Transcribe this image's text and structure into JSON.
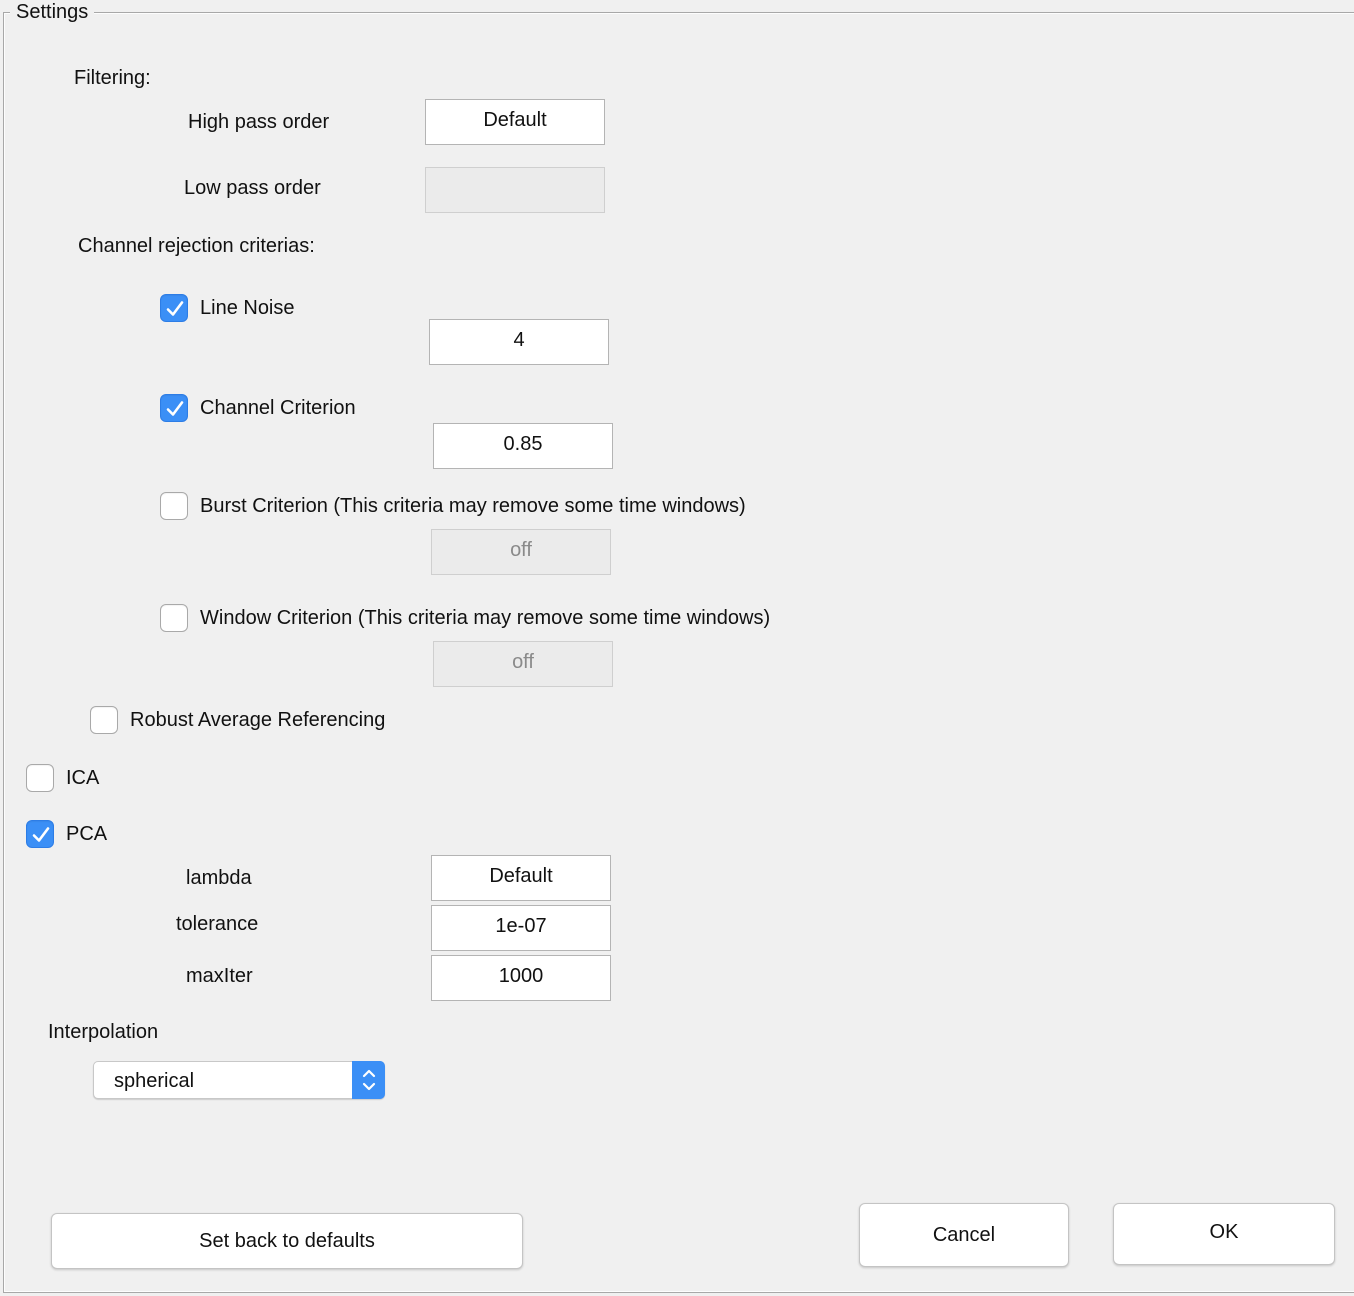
{
  "panel": {
    "title": "Settings"
  },
  "filtering": {
    "heading": "Filtering:",
    "high_pass_label": "High pass order",
    "high_pass_value": "Default",
    "low_pass_label": "Low pass order",
    "low_pass_value": ""
  },
  "channel_rejection": {
    "heading": "Channel rejection criterias:",
    "line_noise": {
      "label": "Line Noise",
      "checked": true,
      "value": "4"
    },
    "channel_criterion": {
      "label": "Channel Criterion",
      "checked": true,
      "value": "0.85"
    },
    "burst_criterion": {
      "label": "Burst Criterion (This criteria may remove some time windows)",
      "checked": false,
      "value": "off"
    },
    "window_criterion": {
      "label": "Window Criterion (This criteria may remove some time windows)",
      "checked": false,
      "value": "off"
    }
  },
  "robust_average": {
    "label": "Robust Average Referencing",
    "checked": false
  },
  "ica": {
    "label": "ICA",
    "checked": false
  },
  "pca": {
    "label": "PCA",
    "checked": true,
    "lambda_label": "lambda",
    "lambda_value": "Default",
    "tolerance_label": "tolerance",
    "tolerance_value": "1e-07",
    "maxiter_label": "maxIter",
    "maxiter_value": "1000"
  },
  "interpolation": {
    "label": "Interpolation",
    "selected": "spherical"
  },
  "buttons": {
    "defaults": "Set back to defaults",
    "cancel": "Cancel",
    "ok": "OK"
  },
  "colors": {
    "accent": "#3b8ff6",
    "background": "#f0f0f0"
  },
  "icons": {
    "checkbox_check": "checkmark-icon",
    "select_arrows": "up-down-chevron-icon"
  }
}
